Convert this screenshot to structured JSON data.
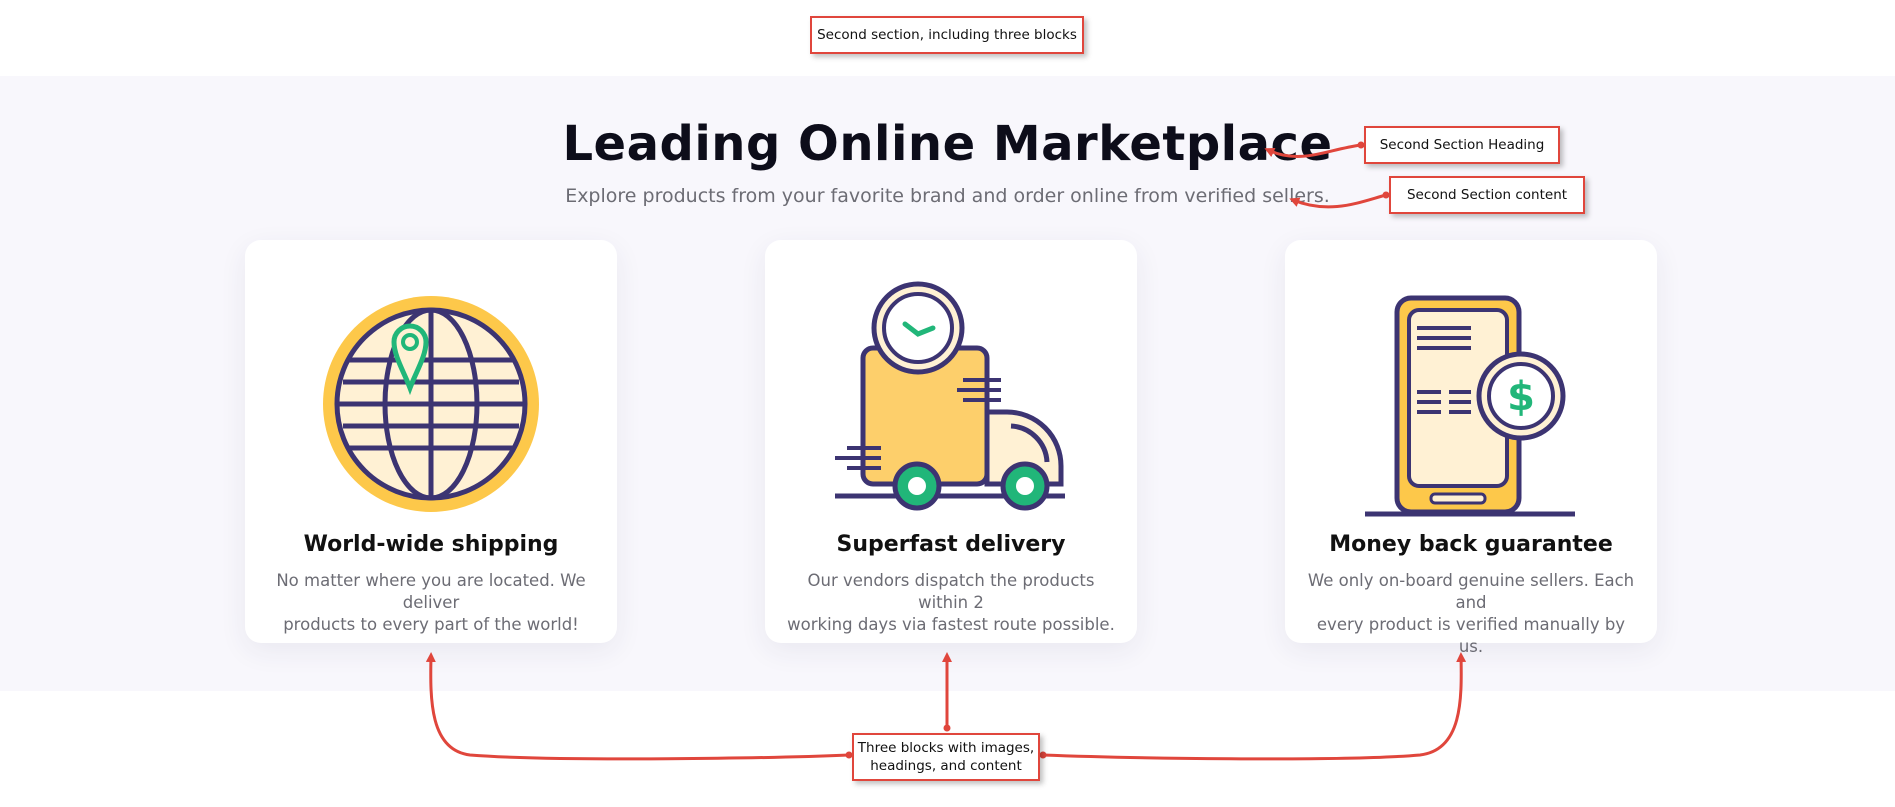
{
  "annotations": {
    "section_label": "Second section, including three blocks",
    "heading_label": "Second Section Heading",
    "content_label": "Second Section content",
    "blocks_label_line1": "Three blocks with images,",
    "blocks_label_line2": "headings, and content"
  },
  "section": {
    "heading": "Leading Online Marketplace",
    "subheading": "Explore products from your favorite brand and order online from verified sellers."
  },
  "cards": [
    {
      "icon": "globe-location-icon",
      "title": "World-wide shipping",
      "desc_line1": "No matter where you are located. We deliver",
      "desc_line2": "products to every part of the world!"
    },
    {
      "icon": "delivery-truck-clock-icon",
      "title": "Superfast delivery",
      "desc_line1": "Our vendors dispatch the products within 2",
      "desc_line2": "working days via fastest route possible."
    },
    {
      "icon": "phone-dollar-icon",
      "title": "Money back guarantee",
      "desc_line1": "We only on-board genuine sellers. Each and",
      "desc_line2": "every product is verified manually by us."
    }
  ],
  "colors": {
    "background": "#ffffff",
    "section_background": "#f8f7fc",
    "annotation_red": "#e0463c",
    "icon_outline": "#3c3472",
    "icon_yellow": "#fdc84a",
    "icon_cream": "#fff1d4",
    "icon_green": "#21b679"
  }
}
